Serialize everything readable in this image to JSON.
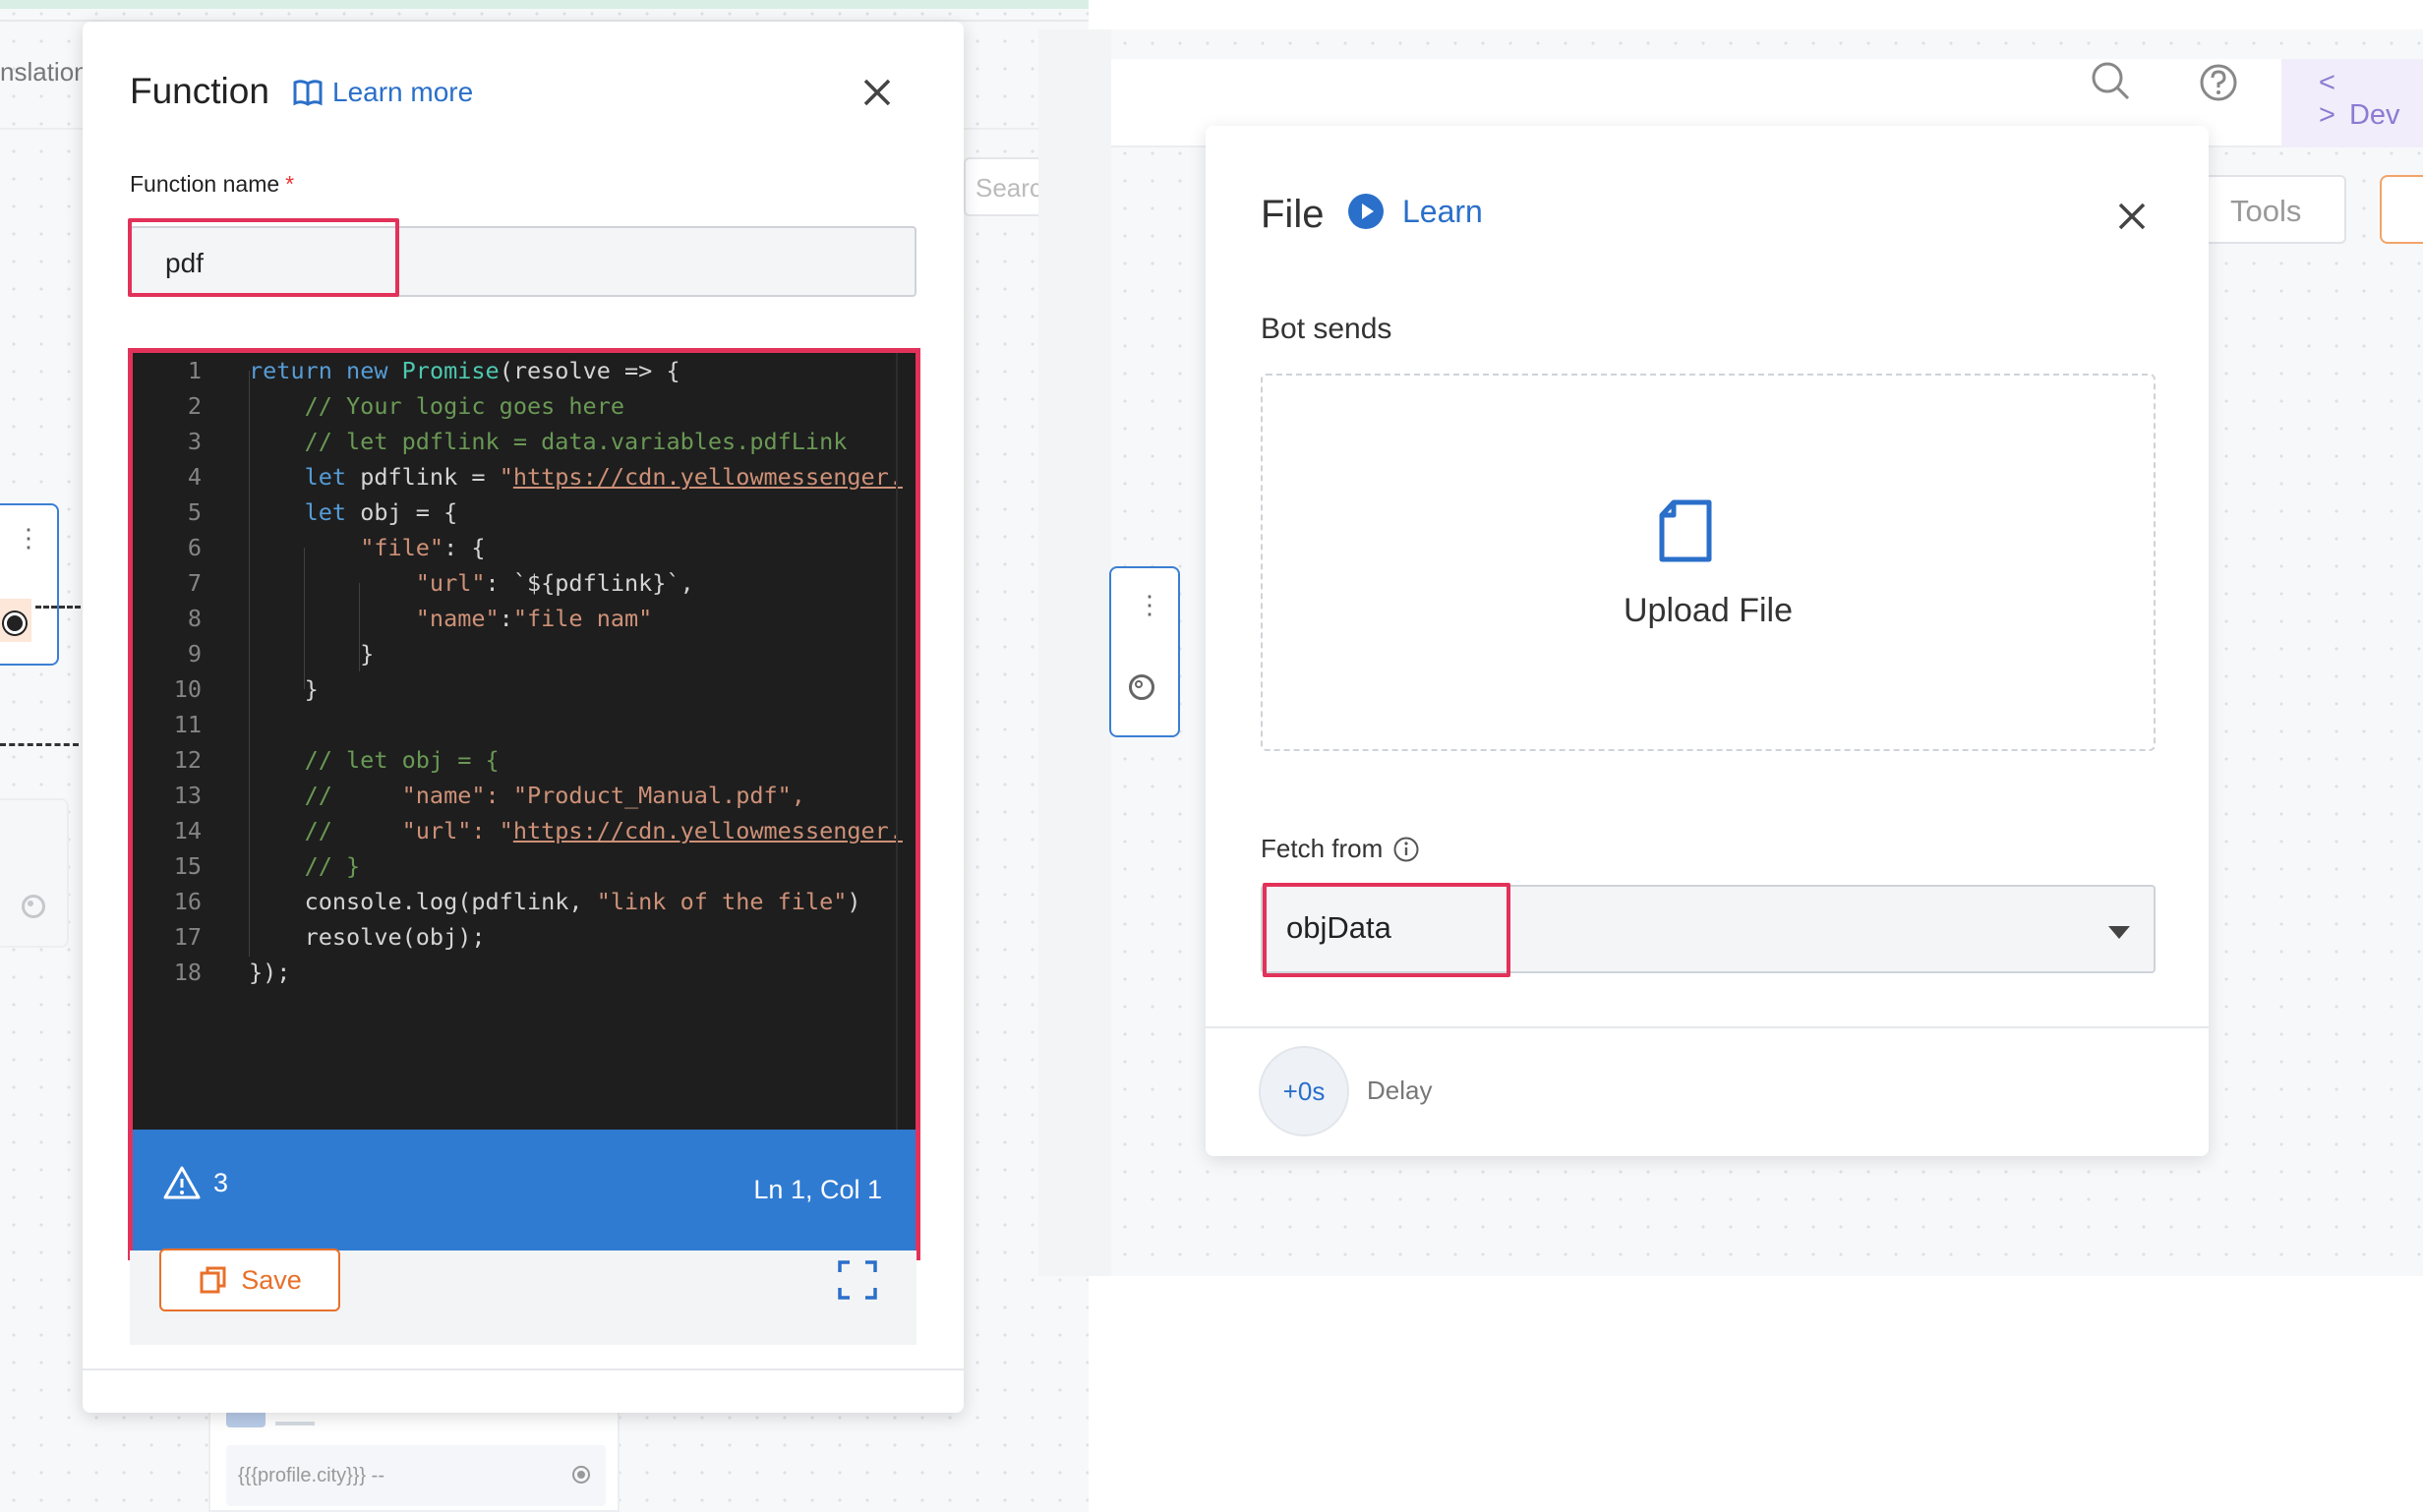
{
  "background": {
    "left_tab_label": "nslation",
    "search_placeholder": "Searc",
    "bottom_field_text": "{{{profile.city}}} --"
  },
  "function_modal": {
    "title": "Function",
    "learn_more": "Learn more",
    "name_label": "Function name",
    "required_mark": "*",
    "name_value": "pdf",
    "code_lines": [
      "return new Promise(resolve => {",
      "    // Your logic goes here",
      "    // let pdflink = data.variables.pdfLink",
      "    let pdflink = \"https://cdn.yellowmessenger.",
      "    let obj = {",
      "        \"file\": {",
      "            \"url\": `${pdflink}`,",
      "            \"name\":\"file nam\"",
      "        }",
      "    }",
      "",
      "    // let obj = {",
      "    //     \"name\": \"Product_Manual.pdf\",",
      "    //     \"url\": \"https://cdn.yellowmessenger.",
      "    // }",
      "    console.log(pdflink, \"link of the file\")",
      "    resolve(obj);",
      "});"
    ],
    "status_warnings": "3",
    "status_position": "Ln 1, Col 1",
    "save_label": "Save",
    "icons": {
      "learn": "book-icon",
      "close": "close-icon",
      "warning": "warning-icon",
      "save": "copy-icon",
      "expand": "fullscreen-icon"
    }
  },
  "right_header": {
    "dev_tab_label": "Dev",
    "tools_label": "Tools",
    "icons": {
      "search": "search-icon",
      "help": "help-icon",
      "code": "code-icon"
    }
  },
  "file_modal": {
    "title": "File",
    "learn_label": "Learn",
    "bot_sends_label": "Bot sends",
    "upload_label": "Upload File",
    "fetch_from_label": "Fetch from",
    "fetch_value": "objData",
    "delay_value": "+0s",
    "delay_label": "Delay",
    "icons": {
      "learn": "play-circle-icon",
      "close": "close-icon",
      "upload": "file-icon",
      "info": "info-icon",
      "dropdown": "caret-down-icon"
    }
  },
  "colors": {
    "accent_blue": "#2f7bd2",
    "highlight_red": "#e2325a",
    "save_orange": "#e8702a",
    "code_bg": "#1e1e1e",
    "dev_tab_purple": "#8d7ad1"
  }
}
